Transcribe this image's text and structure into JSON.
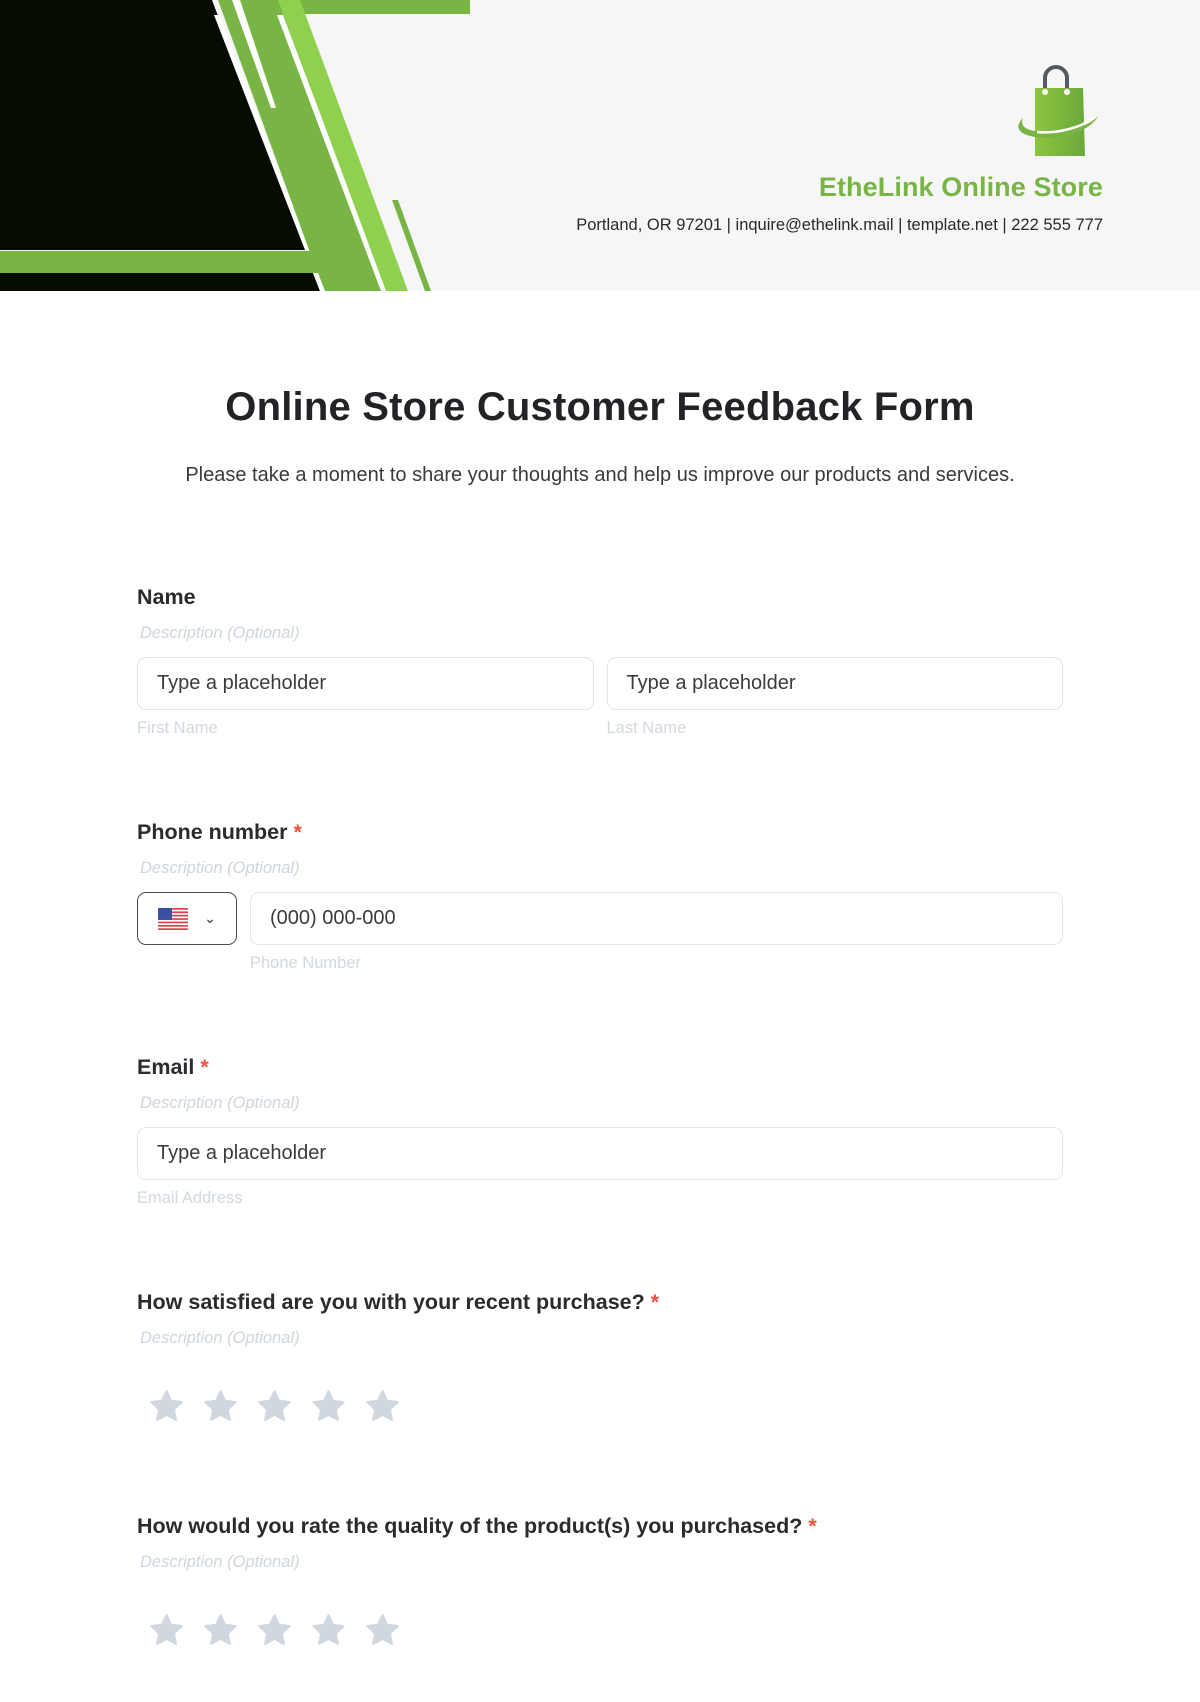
{
  "header": {
    "store_name": "EtheLink Online Store",
    "contact_line": "Portland, OR 97201 | inquire@ethelink.mail | template.net | 222 555 777",
    "logo_icon": "shopping-bag-icon",
    "colors": {
      "accent_green": "#79b544",
      "bright_green": "#8fd14f",
      "dark": "#060c02",
      "header_bg": "#f6f6f6"
    }
  },
  "form": {
    "title": "Online Store Customer Feedback Form",
    "subtitle": "Please take a moment to share your thoughts and help us improve our products and services.",
    "required_marker": "*",
    "fields": [
      {
        "label": "Name",
        "required": false,
        "description": "Description (Optional)",
        "inputs": [
          {
            "placeholder": "Type a placeholder",
            "sublabel": "First Name"
          },
          {
            "placeholder": "Type a placeholder",
            "sublabel": "Last Name"
          }
        ]
      },
      {
        "label": "Phone number",
        "required": true,
        "description": "Description (Optional)",
        "country_flag": "us-flag-icon",
        "inputs": [
          {
            "placeholder": "(000) 000-000",
            "sublabel": "Phone Number"
          }
        ]
      },
      {
        "label": "Email",
        "required": true,
        "description": "Description (Optional)",
        "inputs": [
          {
            "placeholder": "Type a placeholder",
            "sublabel": "Email Address"
          }
        ]
      },
      {
        "label": "How satisfied are you with your recent purchase?",
        "required": true,
        "description": "Description (Optional)",
        "rating": {
          "max": 5,
          "value": 0
        }
      },
      {
        "label": "How would you rate the quality of the product(s) you purchased?",
        "required": true,
        "description": "Description (Optional)",
        "rating": {
          "max": 5,
          "value": 0
        }
      }
    ],
    "colors": {
      "required_red": "#f0523e",
      "star_empty": "#d1d7df",
      "muted_text": "#d2d8e0",
      "input_border": "#e2e6ec"
    }
  }
}
